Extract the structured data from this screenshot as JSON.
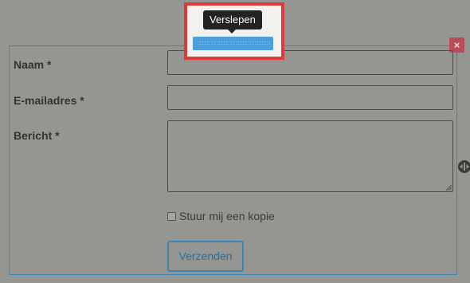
{
  "form": {
    "fields": {
      "naam_label": "Naam *",
      "naam_value": "",
      "email_label": "E-mailadres *",
      "email_value": "",
      "bericht_label": "Bericht *",
      "bericht_value": ""
    },
    "copy_checkbox": {
      "label": "Stuur mij een kopie",
      "checked": false
    },
    "submit_label": "Verzenden",
    "close_label": "×"
  },
  "drag": {
    "tooltip": "Verslepen"
  },
  "colors": {
    "overlay": "#959591",
    "accent": "#3b86b4",
    "drag_handle": "#4aa0dd",
    "close": "#b84c57",
    "highlight": "#e0383f",
    "tooltip_bg": "#232323"
  }
}
